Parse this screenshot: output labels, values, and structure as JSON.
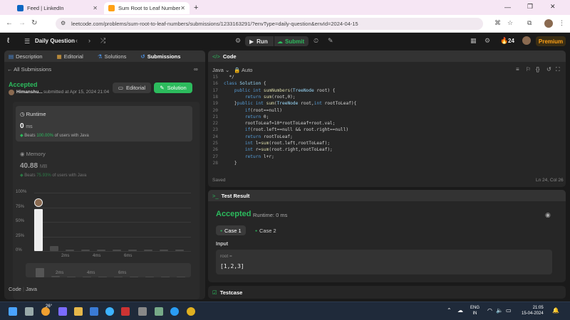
{
  "browser": {
    "tabs": [
      {
        "title": "Feed | LinkedIn"
      },
      {
        "title": "Sum Root to Leaf Numbers - L..."
      }
    ],
    "url": "leetcode.com/problems/sum-root-to-leaf-numbers/submissions/1233163291/?envType=daily-question&envId=2024-04-15"
  },
  "header": {
    "daily": "Daily Question",
    "run": "Run",
    "submit": "Submit",
    "streak": "24",
    "premium": "Premium"
  },
  "left": {
    "tabs": [
      "Description",
      "Editorial",
      "Solutions",
      "Submissions"
    ],
    "all_submissions": "All Submissions",
    "status": "Accepted",
    "user": "Himanshu...",
    "submitted": "submitted at Apr 15, 2024 21:04",
    "editorial_btn": "Editorial",
    "solution_btn": "Solution",
    "runtime_label": "Runtime",
    "runtime_value": "0",
    "runtime_unit": "ms",
    "runtime_beats_prefix": "Beats",
    "runtime_beats": "100.00%",
    "runtime_beats_suffix": "of users with Java",
    "memory_label": "Memory",
    "memory_value": "40.88",
    "memory_unit": "MB",
    "memory_beats_prefix": "Beats",
    "memory_beats": "75.93%",
    "memory_beats_suffix": "of users with Java",
    "code_label": "Code",
    "lang_label": "Java"
  },
  "chart_data": {
    "type": "bar",
    "yticks": [
      "100%",
      "75%",
      "50%",
      "25%",
      "0%"
    ],
    "xticks": [
      "2ms",
      "4ms",
      "6ms"
    ],
    "ylim": [
      0,
      100
    ],
    "values": [
      72,
      9,
      2,
      2,
      2,
      2,
      2,
      2,
      2,
      2
    ]
  },
  "code": {
    "title": "Code",
    "lang": "Java",
    "mode": "Auto",
    "saved": "Saved",
    "cursor": "Ln 24, Col 26",
    "lines": [
      {
        "n": "15",
        "t": "  */"
      },
      {
        "n": "16",
        "t": "class Solution {"
      },
      {
        "n": "17",
        "t": "    public int sumNumbers(TreeNode root) {"
      },
      {
        "n": "18",
        "t": "        return sum(root,0);"
      },
      {
        "n": "19",
        "t": "    }public int sum(TreeNode root,int rootToLeaf){"
      },
      {
        "n": "20",
        "t": "        if(root==null)"
      },
      {
        "n": "21",
        "t": "        return 0;"
      },
      {
        "n": "22",
        "t": "        rootToLeaf=10*rootToLeaf+root.val;"
      },
      {
        "n": "23",
        "t": "        if(root.left==null && root.right==null)"
      },
      {
        "n": "24",
        "t": "        return rootToLeaf;"
      },
      {
        "n": "25",
        "t": "        int l=sum(root.left,rootToLeaf);"
      },
      {
        "n": "26",
        "t": "        int r=sum(root.right,rootToLeaf);"
      },
      {
        "n": "27",
        "t": "        return l+r;"
      },
      {
        "n": "28",
        "t": "    }"
      }
    ]
  },
  "result": {
    "title": "Test Result",
    "status": "Accepted",
    "runtime": "Runtime: 0 ms",
    "case1": "Case 1",
    "case2": "Case 2",
    "input_label": "Input",
    "var_name": "root =",
    "var_value": "[1,2,3]",
    "testcase": "Testcase"
  },
  "taskbar": {
    "temp": "26°",
    "lang1": "ENG",
    "lang2": "IN",
    "time": "21:05",
    "date": "15-04-2024"
  }
}
